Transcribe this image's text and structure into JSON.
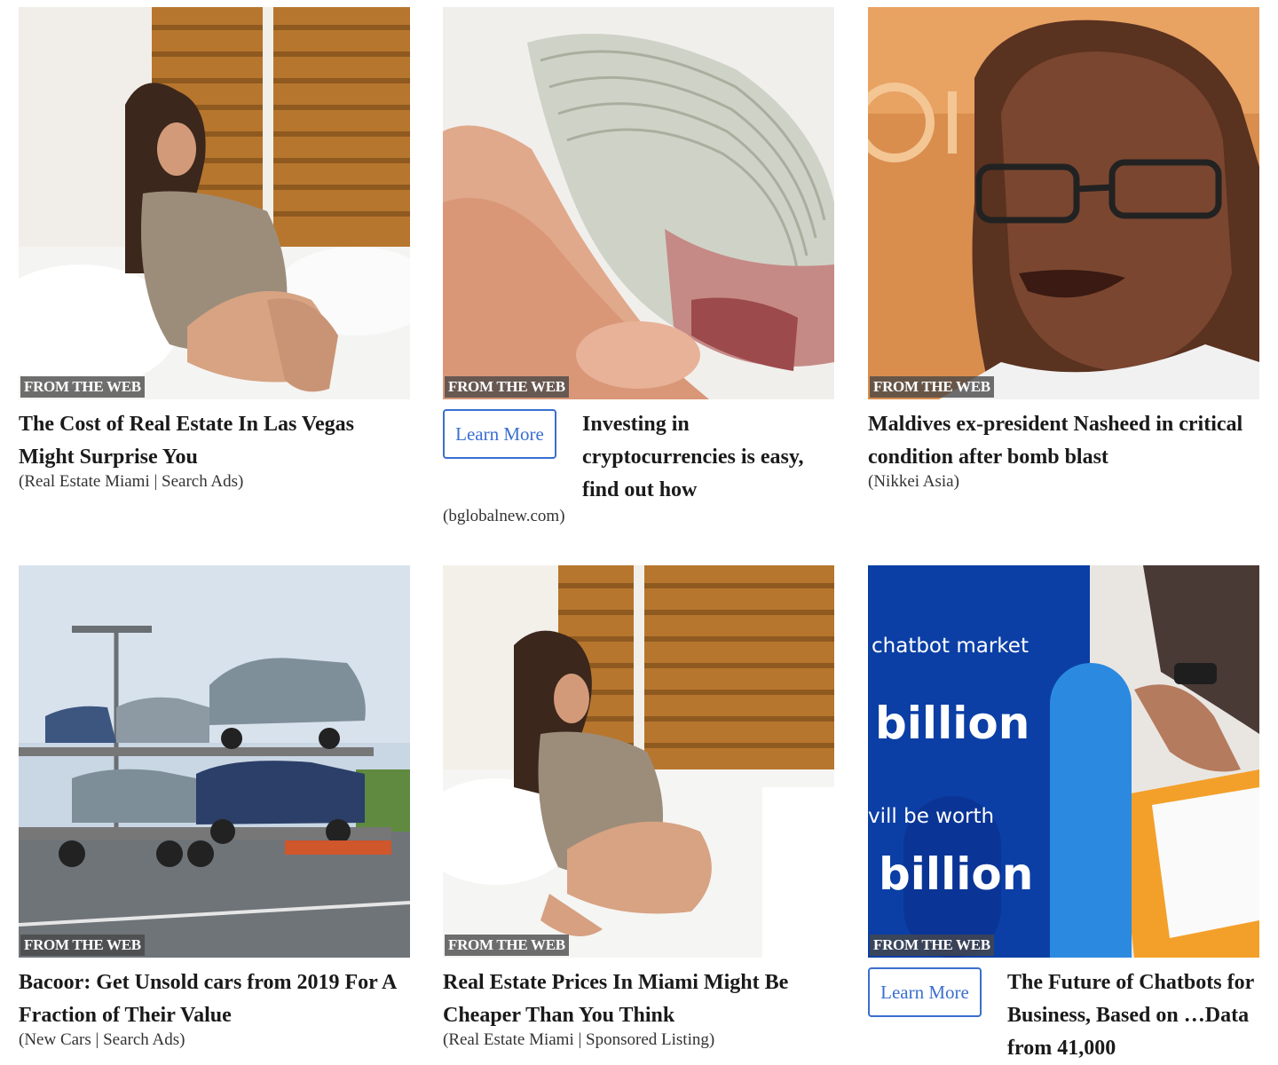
{
  "cards": [
    {
      "badge": "FROM THE WEB",
      "title": "The Cost of Real Estate In Las Vegas Might Surprise You",
      "source": "(Real Estate Miami | Search Ads)"
    },
    {
      "badge": "FROM THE WEB",
      "title": "Investing in cryptocurrencies is easy, find out how",
      "source": "(bglobalnew.com)",
      "cta": "Learn More"
    },
    {
      "badge": "FROM THE WEB",
      "title": "Maldives ex-president Nasheed in critical condition after bomb blast",
      "source": "(Nikkei Asia)"
    },
    {
      "badge": "FROM THE WEB",
      "title": "Bacoor: Get Unsold cars from 2019 For A Fraction of Their Value",
      "source": "(New Cars | Search Ads)"
    },
    {
      "badge": "FROM THE WEB",
      "title": "Real Estate Prices In Miami Might Be Cheaper Than You Think",
      "source": "(Real Estate Miami | Sponsored Listing)"
    },
    {
      "badge": "FROM THE WEB",
      "title": "The Future of Chatbots for Business, Based on …Data from 41,000",
      "cta": "Learn More",
      "image_text": {
        "line1": "chatbot market",
        "line2": "billion",
        "line3": "vill be worth",
        "line4": "billion"
      }
    }
  ],
  "colors": {
    "cta_border": "#3a6fd0",
    "chatbot_blue": "#0b3fa6"
  }
}
